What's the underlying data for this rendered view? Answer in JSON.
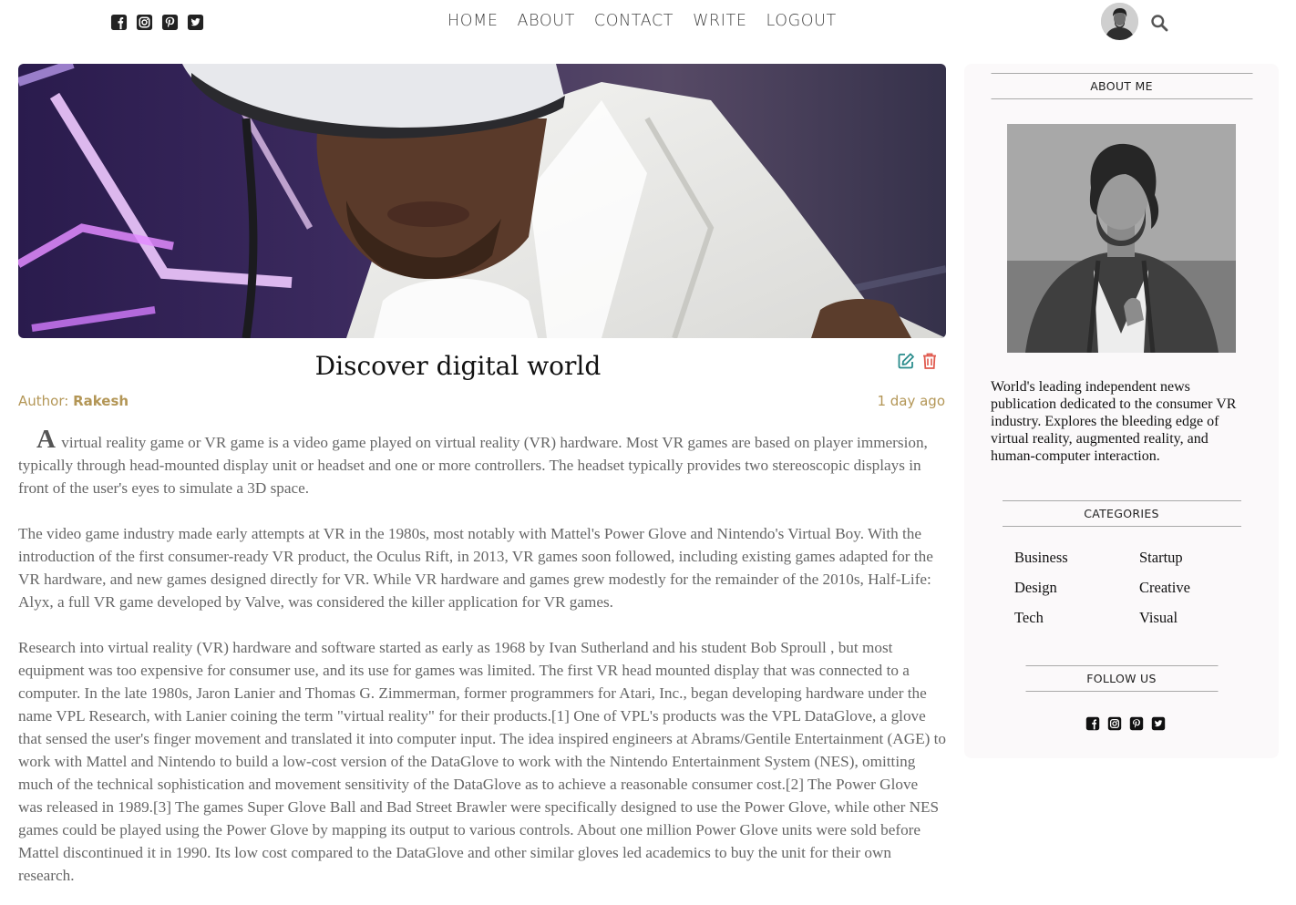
{
  "nav": {
    "social": [
      "facebook-icon",
      "instagram-icon",
      "pinterest-icon",
      "twitter-icon"
    ],
    "links": [
      "HOME",
      "ABOUT",
      "CONTACT",
      "WRITE",
      "LOGOUT"
    ]
  },
  "post": {
    "title": "Discover digital world",
    "author_label": "Author: ",
    "author_name": "Rakesh",
    "date": "1 day ago",
    "dropcap": "A",
    "paragraphs": [
      " virtual reality game or VR game is a video game played on virtual reality (VR) hardware. Most VR games are based on player immersion, typically through head-mounted display unit or headset and one or more controllers. The headset typically provides two stereoscopic displays in front of the user's eyes to simulate a 3D space.",
      "The video game industry made early attempts at VR in the 1980s, most notably with Mattel's Power Glove and Nintendo's Virtual Boy. With the introduction of the first consumer-ready VR product, the Oculus Rift, in 2013, VR games soon followed, including existing games adapted for the VR hardware, and new games designed directly for VR. While VR hardware and games grew modestly for the remainder of the 2010s, Half-Life: Alyx, a full VR game developed by Valve, was considered the killer application for VR games.",
      "Research into virtual reality (VR) hardware and software started as early as 1968 by Ivan Sutherland and his student Bob Sproull , but most equipment was too expensive for consumer use, and its use for games was limited. The first VR head mounted display that was connected to a computer. In the late 1980s, Jaron Lanier and Thomas G. Zimmerman, former programmers for Atari, Inc., began developing hardware under the name VPL Research, with Lanier coining the term \"virtual reality\" for their products.[1] One of VPL's products was the VPL DataGlove, a glove that sensed the user's finger movement and translated it into computer input. The idea inspired engineers at Abrams/Gentile Entertainment (AGE) to work with Mattel and Nintendo to build a low-cost version of the DataGlove to work with the Nintendo Entertainment System (NES), omitting much of the technical sophistication and movement sensitivity of the DataGlove as to achieve a reasonable consumer cost.[2] The Power Glove was released in 1989.[3] The games Super Glove Ball and Bad Street Brawler were specifically designed to use the Power Glove, while other NES games could be played using the Power Glove by mapping its output to various controls. About one million Power Glove units were sold before Mattel discontinued it in 1990. Its low cost compared to the DataGlove and other similar gloves led academics to buy the unit for their own research."
    ]
  },
  "sidebar": {
    "about_title": "ABOUT ME",
    "about_text": "World's leading independent news publication dedicated to the consumer VR industry. Explores the bleeding edge of virtual reality, augmented reality, and human-computer interaction.",
    "categories_title": "CATEGORIES",
    "categories": [
      "Business",
      "Startup",
      "Design",
      "Creative",
      "Tech",
      "Visual"
    ],
    "follow_title": "FOLLOW US"
  },
  "colors": {
    "accent": "#b39656",
    "edit_icon": "#2a8c8c",
    "delete_icon": "#e05a4e",
    "sidebar_bg": "#fbf9fa"
  }
}
